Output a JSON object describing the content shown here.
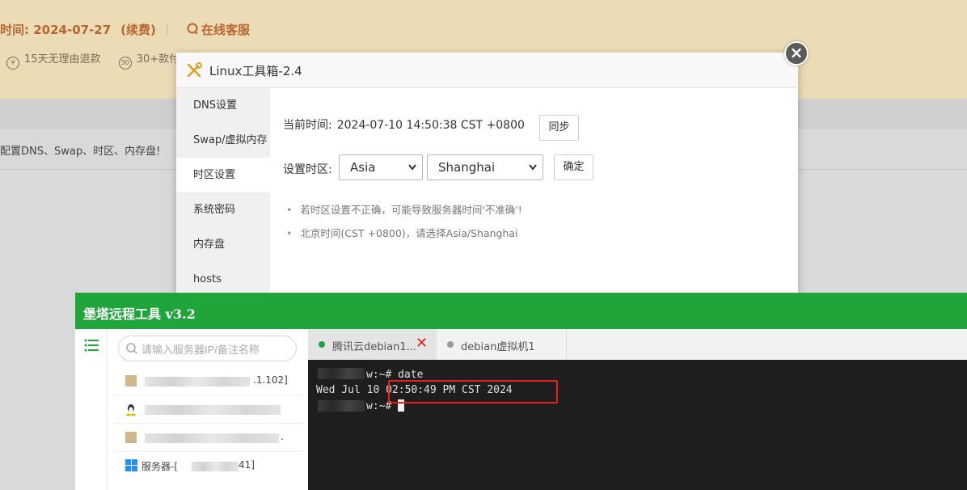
{
  "background": {
    "expire_text": "时间: 2024-07-27",
    "renew_label": "(续费)",
    "service_label": "在线客服",
    "features": [
      "15天无理由退款",
      "30+款付"
    ],
    "row_text": "配置DNS、Swap、时区、内存盘!"
  },
  "dialog": {
    "title": "Linux工具箱-2.4",
    "close_symbol": "×",
    "menu": [
      {
        "label": "DNS设置"
      },
      {
        "label": "Swap/虚拟内存"
      },
      {
        "label": "时区设置"
      },
      {
        "label": "系统密码"
      },
      {
        "label": "内存盘"
      },
      {
        "label": "hosts"
      }
    ],
    "active_menu": "时区设置",
    "current_time_label": "当前时间:",
    "current_time_value": "2024-07-10 14:50:38 CST +0800",
    "sync_button": "同步",
    "timezone_label": "设置时区:",
    "region_selected": "Asia",
    "city_selected": "Shanghai",
    "confirm_button": "确定",
    "notes": [
      "若时区设置不正确，可能导致服务器时间'不准确'!",
      "北京时间(CST +0800)，请选择Asia/Shanghai"
    ]
  },
  "baota": {
    "title": "堡塔远程工具 v3.2",
    "search_placeholder": "请输入服务器IP/备注名称",
    "servers": [
      {
        "suffix": ".1.102]"
      },
      {
        "suffix": ""
      },
      {
        "suffix": "."
      },
      {
        "prefix": "服务器-[",
        "suffix": "41]"
      }
    ],
    "tabs": [
      {
        "label": "腾讯云debian1...",
        "active": true,
        "status_color": "#20a53a"
      },
      {
        "label": "debian虚拟机1",
        "active": false,
        "status_color": "#999999"
      }
    ],
    "tab_close_symbol": "✕",
    "terminal": {
      "line1": "w:~# date",
      "line2": "Wed Jul 10 02:50:49 PM CST 2024",
      "line3": "w:~# "
    }
  },
  "colors": {
    "baota_green": "#20a53a",
    "highlight_red": "#e8201a",
    "banner_brown": "#b9652f"
  }
}
